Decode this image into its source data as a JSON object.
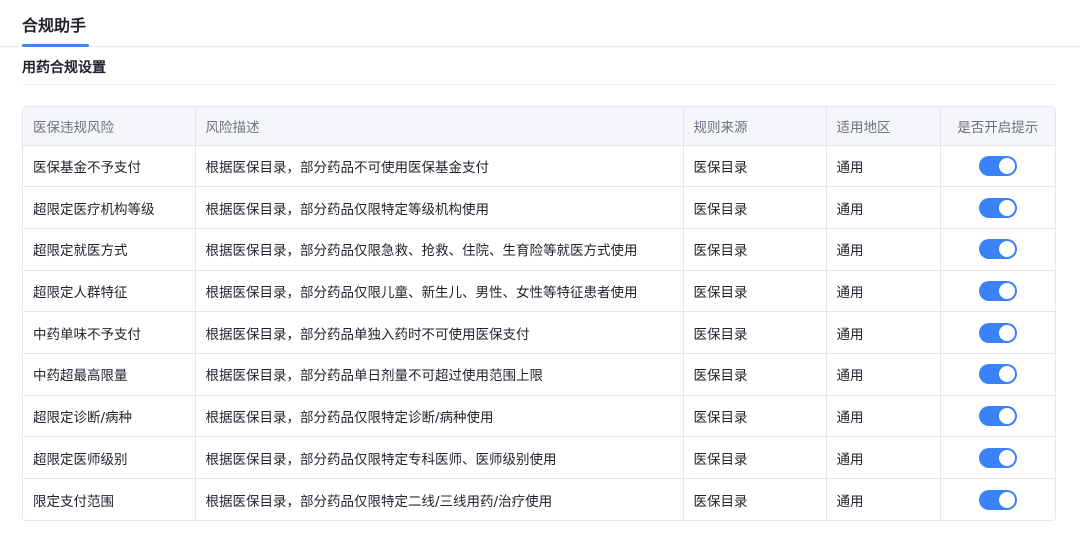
{
  "tab": {
    "label": "合规助手"
  },
  "section": {
    "title": "用药合规设置"
  },
  "colors": {
    "accent": "#3b82f6",
    "toggle_on": "#3b82f6"
  },
  "table": {
    "headers": [
      "医保违规风险",
      "风险描述",
      "规则来源",
      "适用地区",
      "是否开启提示"
    ],
    "rows": [
      {
        "risk": "医保基金不予支付",
        "desc": "根据医保目录，部分药品不可使用医保基金支付",
        "source": "医保目录",
        "region": "通用",
        "enabled": true
      },
      {
        "risk": "超限定医疗机构等级",
        "desc": "根据医保目录，部分药品仅限特定等级机构使用",
        "source": "医保目录",
        "region": "通用",
        "enabled": true
      },
      {
        "risk": "超限定就医方式",
        "desc": "根据医保目录，部分药品仅限急救、抢救、住院、生育险等就医方式使用",
        "source": "医保目录",
        "region": "通用",
        "enabled": true
      },
      {
        "risk": "超限定人群特征",
        "desc": "根据医保目录，部分药品仅限儿童、新生儿、男性、女性等特征患者使用",
        "source": "医保目录",
        "region": "通用",
        "enabled": true
      },
      {
        "risk": "中药单味不予支付",
        "desc": "根据医保目录，部分药品单独入药时不可使用医保支付",
        "source": "医保目录",
        "region": "通用",
        "enabled": true
      },
      {
        "risk": "中药超最高限量",
        "desc": "根据医保目录，部分药品单日剂量不可超过使用范围上限",
        "source": "医保目录",
        "region": "通用",
        "enabled": true
      },
      {
        "risk": "超限定诊断/病种",
        "desc": "根据医保目录，部分药品仅限特定诊断/病种使用",
        "source": "医保目录",
        "region": "通用",
        "enabled": true
      },
      {
        "risk": "超限定医师级别",
        "desc": "根据医保目录，部分药品仅限特定专科医师、医师级别使用",
        "source": "医保目录",
        "region": "通用",
        "enabled": true
      },
      {
        "risk": "限定支付范围",
        "desc": "根据医保目录，部分药品仅限特定二线/三线用药/治疗使用",
        "source": "医保目录",
        "region": "通用",
        "enabled": true
      }
    ]
  }
}
